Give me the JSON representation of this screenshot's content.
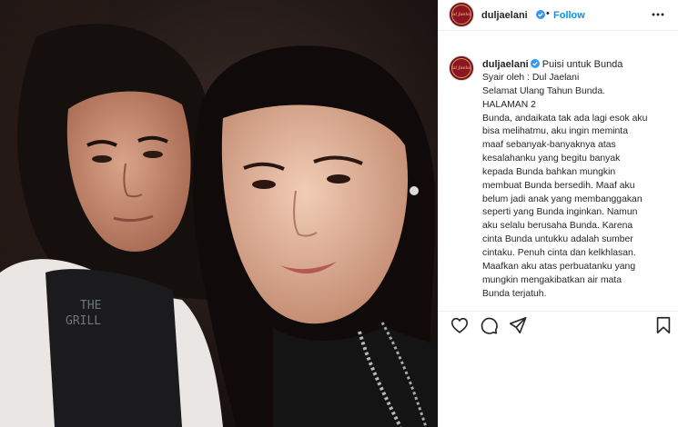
{
  "post": {
    "username": "duljaelani",
    "verified": true,
    "separator": "•",
    "follow_label": "Follow",
    "avatar_text": "Dul Jaelani"
  },
  "caption": {
    "username": "duljaelani",
    "title": "Puisi untuk Bunda",
    "lines": [
      "Syair oleh : Dul Jaelani",
      "Selamat Ulang Tahun Bunda.",
      "HALAMAN 2",
      "Bunda, andaikata tak ada lagi esok aku",
      "bisa melihatmu, aku ingin meminta",
      "maaf sebanyak-banyaknya atas",
      "kesalahanku yang begitu banyak",
      "kepada Bunda bahkan mungkin",
      "membuat Bunda bersedih. Maaf aku",
      "belum jadi anak yang membanggakan",
      "seperti yang Bunda inginkan. Namun",
      "aku selalu berusaha Bunda. Karena",
      "cinta Bunda untukku adalah sumber",
      "cintaku. Penuh cinta dan kelkhlasan.",
      "Maafkan aku atas perbuatanku yang",
      "mungkin mengakibatkan air mata",
      "Bunda terjatuh."
    ]
  },
  "photo": {
    "shirt_text_line1": "THE",
    "shirt_text_line2": "GRILL"
  },
  "icons": {
    "like": "heart-icon",
    "comment": "comment-icon",
    "share": "paper-plane-icon",
    "save": "bookmark-icon",
    "verified": "verified-badge-icon",
    "more": "more-options-icon"
  },
  "colors": {
    "follow": "#0095f6",
    "verified": "#3897f0",
    "avatar_bg": "#8d1420"
  }
}
